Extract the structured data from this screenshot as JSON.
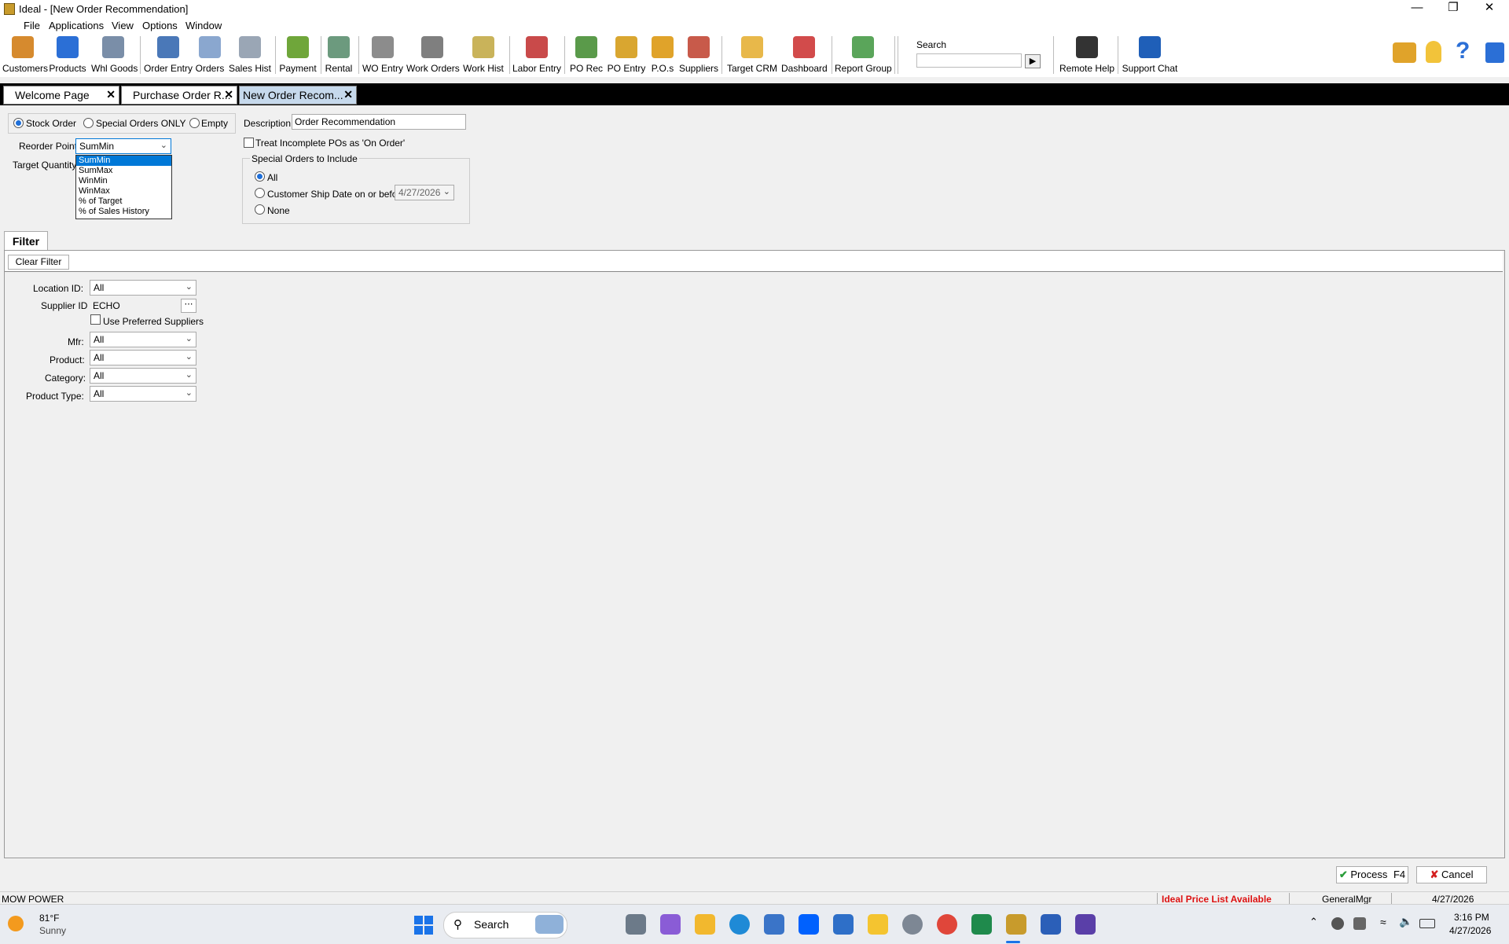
{
  "window": {
    "title": "Ideal - [New Order Recommendation]"
  },
  "menu": [
    "File",
    "Applications",
    "View",
    "Options",
    "Window"
  ],
  "toolbar": [
    {
      "label": "Customers",
      "icon": "customers-icon",
      "color": "#d68a2e"
    },
    {
      "label": "Products",
      "icon": "products-icon",
      "color": "#2b6fd6"
    },
    {
      "label": "Whl Goods",
      "icon": "gauge-icon",
      "color": "#7a8ea8"
    },
    {
      "label": "Order Entry",
      "icon": "order-entry-icon",
      "color": "#4a78b8"
    },
    {
      "label": "Orders",
      "icon": "orders-icon",
      "color": "#8aa7cf"
    },
    {
      "label": "Sales Hist",
      "icon": "sales-hist-icon",
      "color": "#9aa6b5"
    },
    {
      "label": "Payment",
      "icon": "payment-icon",
      "color": "#6fa63a"
    },
    {
      "label": "Rental",
      "icon": "rental-icon",
      "color": "#6c9a7e"
    },
    {
      "label": "WO Entry",
      "icon": "wrench-icon",
      "color": "#8c8c8c"
    },
    {
      "label": "Work Orders",
      "icon": "tools-icon",
      "color": "#7f7f7f"
    },
    {
      "label": "Work Hist",
      "icon": "work-hist-icon",
      "color": "#c9b35a"
    },
    {
      "label": "Labor Entry",
      "icon": "calendar-clock-icon",
      "color": "#c94a4a"
    },
    {
      "label": "PO Rec",
      "icon": "po-rec-icon",
      "color": "#5a9a4a"
    },
    {
      "label": "PO Entry",
      "icon": "po-entry-icon",
      "color": "#d9a630"
    },
    {
      "label": "P.O.s",
      "icon": "box-icon",
      "color": "#e0a32a"
    },
    {
      "label": "Suppliers",
      "icon": "factory-icon",
      "color": "#c85a4a"
    },
    {
      "label": "Target CRM",
      "icon": "target-icon",
      "color": "#e8b84a"
    },
    {
      "label": "Dashboard",
      "icon": "dashboard-icon",
      "color": "#d24b4b"
    },
    {
      "label": "Report Group",
      "icon": "report-group-icon",
      "color": "#5aa55a"
    },
    {
      "label": "Remote Help",
      "icon": "remote-help-icon",
      "color": "#333333"
    },
    {
      "label": "Support Chat",
      "icon": "chat-icon",
      "color": "#1f5fb8"
    }
  ],
  "search": {
    "label": "Search",
    "value": ""
  },
  "tabs": [
    {
      "label": "Welcome Page",
      "close": "✕"
    },
    {
      "label": "Purchase Order R...",
      "close": "✕"
    },
    {
      "label": "New Order Recom...",
      "close": "✕"
    }
  ],
  "form": {
    "order_types": [
      "Stock Order",
      "Special Orders ONLY",
      "Empty"
    ],
    "order_type_selected": "Stock Order",
    "description_label": "Description:",
    "description_value": "Order Recommendation",
    "reorder_point_label": "Reorder Point:",
    "reorder_point_value": "SumMin",
    "reorder_point_options": [
      "SumMin",
      "SumMax",
      "WinMin",
      "WinMax",
      "% of Target",
      "% of Sales History"
    ],
    "target_quantity_label": "Target Quantity:",
    "treat_incomplete_label": "Treat Incomplete POs as 'On Order'",
    "special_orders_group": "Special Orders to Include",
    "special_options": [
      "All",
      "Customer Ship Date on or before:",
      "None"
    ],
    "ship_date_value": "4/27/2026"
  },
  "filter": {
    "tab_label": "Filter",
    "clear_label": "Clear Filter",
    "location_label": "Location ID:",
    "location_value": "All",
    "supplier_label": "Supplier ID",
    "supplier_value": "ECHO",
    "use_preferred_label": "Use Preferred Suppliers",
    "mfr_label": "Mfr:",
    "mfr_value": "All",
    "product_label": "Product:",
    "product_value": "All",
    "category_label": "Category:",
    "category_value": "All",
    "product_type_label": "Product Type:",
    "product_type_value": "All"
  },
  "buttons": {
    "process": "Process",
    "process_key": "F4",
    "cancel": "Cancel"
  },
  "status": {
    "left": "MOW POWER",
    "price_list": "Ideal Price List Available",
    "user": "GeneralMgr",
    "date": "4/27/2026"
  },
  "taskbar": {
    "temp": "81°F",
    "weather": "Sunny",
    "search": "Search",
    "time": "3:16 PM",
    "date": "4/27/2026"
  }
}
